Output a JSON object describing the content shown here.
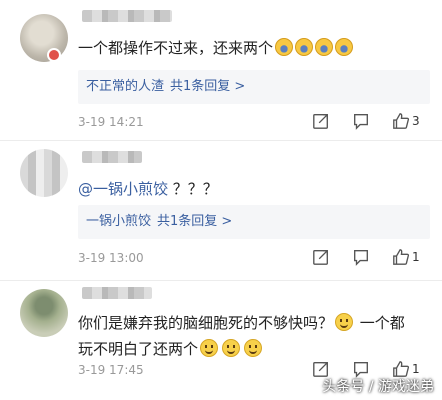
{
  "comments": [
    {
      "text": "一个都操作不过来，还来两个",
      "reply_author": "不正常的人渣",
      "reply_count": "共1条回复 >",
      "time": "3-19 14:21",
      "likes": "3"
    },
    {
      "mention": "@一锅小煎饺",
      "text": "？？？",
      "reply_author": "一锅小煎饺",
      "reply_count": "共1条回复 >",
      "time": "3-19 13:00",
      "likes": "1"
    },
    {
      "text_line1": "你们是嫌弃我的脑细胞死的不够快吗？",
      "text_line1b": "一个都",
      "text_line2": "玩不明白了还两个",
      "time": "3-19 17:45",
      "likes": "1"
    }
  ],
  "watermark": "头条号 / 游戏迷弟",
  "icons": [
    "share-icon",
    "comment-icon",
    "thumbs-up-icon",
    "laughing-emoji-icon",
    "smile-emoji-icon"
  ]
}
